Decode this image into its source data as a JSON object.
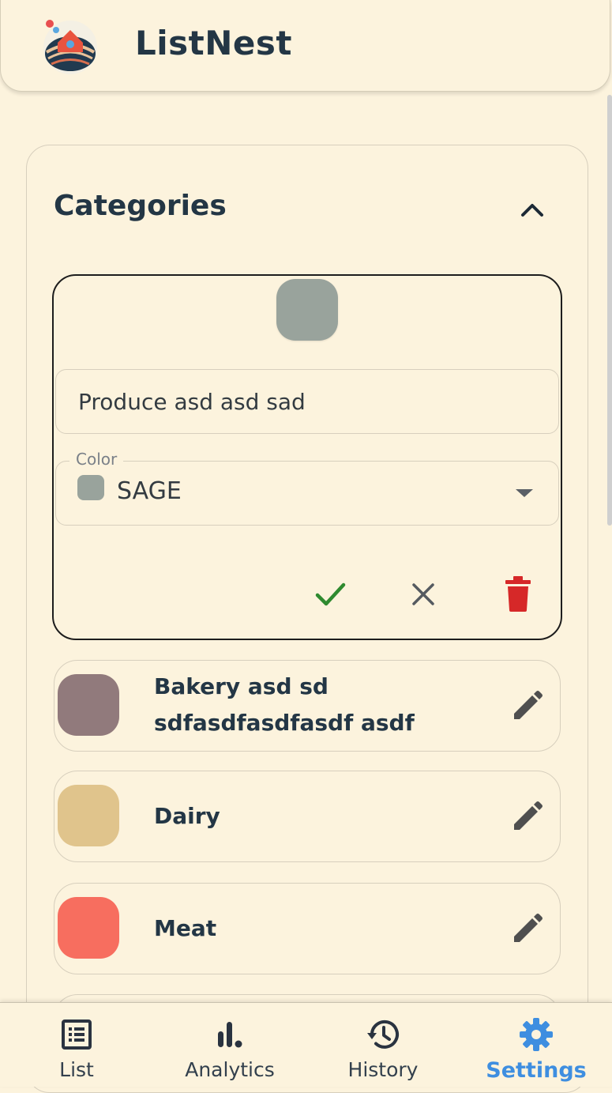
{
  "app": {
    "title": "ListNest"
  },
  "panel": {
    "title": "Categories"
  },
  "edit_card": {
    "name_value": "Produce asd asd sad",
    "color_label": "Color",
    "color_value": "SAGE",
    "swatch_color": "#99a39c"
  },
  "categories": [
    {
      "name_line1": "Bakery asd sd",
      "name_line2": "sdfasdfasdfasdf asdf",
      "color": "#917a7c"
    },
    {
      "name": "Dairy",
      "color": "#e0c48c"
    },
    {
      "name": "Meat",
      "color": "#f76e5f"
    }
  ],
  "nav": {
    "items": [
      {
        "label": "List",
        "icon": "list-icon"
      },
      {
        "label": "Analytics",
        "icon": "bar-chart-icon"
      },
      {
        "label": "History",
        "icon": "history-icon"
      },
      {
        "label": "Settings",
        "icon": "gear-icon",
        "active": true
      }
    ]
  },
  "colors": {
    "background": "#fcf3dd",
    "primary_text": "#233645",
    "accent": "#3e8ee0",
    "confirm": "#2f8a2f",
    "delete": "#d62828"
  }
}
